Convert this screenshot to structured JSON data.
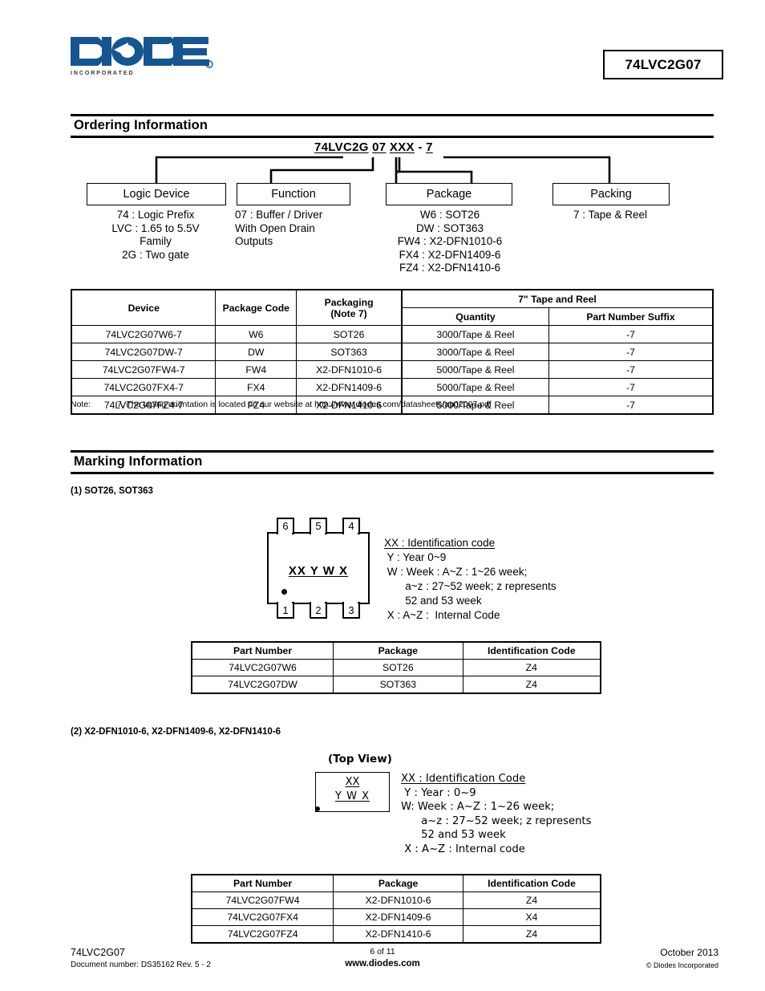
{
  "header": {
    "logo_text": "DIODES",
    "logo_sub": "I N C O R P O R A T E D",
    "logo_color": "#17558f",
    "part_number": "74LVC2G07"
  },
  "sections": {
    "ordering_title": "Ordering Information",
    "marking_title": "Marking Information"
  },
  "ordering_diagram": {
    "code_parts": {
      "p1": "74LVC2G",
      "p2": "07",
      "p3": "XXX",
      "dash": "-",
      "p4": "7"
    },
    "boxes": [
      {
        "label": "Logic Device"
      },
      {
        "label": "Function"
      },
      {
        "label": "Package"
      },
      {
        "label": "Packing"
      }
    ],
    "captions": {
      "logic_device": "74 : Logic Prefix\nLVC : 1.65 to 5.5V\nFamily\n2G : Two gate",
      "function": "07 :  Buffer / Driver\nWith Open Drain\nOutputs",
      "package": "W6 : SOT26\nDW : SOT363\nFW4 : X2-DFN1010-6\nFX4 : X2-DFN1409-6\nFZ4 : X2-DFN1410-6",
      "packing": "7 : Tape & Reel"
    }
  },
  "ordering_table": {
    "headers": {
      "device": "Device",
      "package_code": "Package Code",
      "packaging_l1": "Packaging",
      "packaging_l2": "(Note 7)",
      "tape_reel": "7\" Tape and Reel",
      "quantity": "Quantity",
      "suffix": "Part Number Suffix"
    },
    "rows": [
      {
        "device": "74LVC2G07W6-7",
        "code": "W6",
        "packaging": "SOT26",
        "qty": "3000/Tape & Reel",
        "suffix": "-7"
      },
      {
        "device": "74LVC2G07DW-7",
        "code": "DW",
        "packaging": "SOT363",
        "qty": "3000/Tape & Reel",
        "suffix": "-7"
      },
      {
        "device": "74LVC2G07FW4-7",
        "code": "FW4",
        "packaging": "X2-DFN1010-6",
        "qty": "5000/Tape & Reel",
        "suffix": "-7"
      },
      {
        "device": "74LVC2G07FX4-7",
        "code": "FX4",
        "packaging": "X2-DFN1409-6",
        "qty": "5000/Tape & Reel",
        "suffix": "-7"
      },
      {
        "device": "74LVC2G07FZ4-7",
        "code": "FZ4",
        "packaging": "X2-DFN1410-6",
        "qty": "5000/Tape & Reel",
        "suffix": "-7"
      }
    ]
  },
  "note": {
    "label": "Note:",
    "text": "7. The taping orientation is located on our website at http://www.diodes.com/datasheets/ap02007.pdf"
  },
  "marking1": {
    "heading": "(1) SOT26, SOT363",
    "pins_top": [
      "6",
      "5",
      "4"
    ],
    "pins_bottom": [
      "1",
      "2",
      "3"
    ],
    "mark_line": "XX Y W X",
    "legend_lines": [
      "XX : Identification code",
      " Y : Year 0~9",
      " W : Week : A~Z : 1~26 week;",
      "       a~z : 27~52 week; z represents",
      "       52 and 53 week",
      " X : A~Z :  Internal Code"
    ],
    "table": {
      "headers": {
        "part": "Part Number",
        "package": "Package",
        "ident": "Identification Code"
      },
      "rows": [
        {
          "part": "74LVC2G07W6",
          "package": "SOT26",
          "ident": "Z4"
        },
        {
          "part": "74LVC2G07DW",
          "package": "SOT363",
          "ident": "Z4"
        }
      ]
    }
  },
  "marking2": {
    "heading": "(2) X2-DFN1010-6, X2-DFN1409-6, X2-DFN1410-6",
    "top_view_label": "(Top View)",
    "mark_line1": "XX",
    "mark_line2": "Y W X",
    "legend_lines": [
      "XX : Identification Code",
      " Y : Year : 0~9",
      "W: Week : A~Z : 1~26 week;",
      "      a~z : 27~52 week; z represents",
      "      52 and 53 week",
      " X : A~Z : Internal code"
    ],
    "table": {
      "headers": {
        "part": "Part Number",
        "package": "Package",
        "ident": "Identification Code"
      },
      "rows": [
        {
          "part": "74LVC2G07FW4",
          "package": "X2-DFN1010-6",
          "ident": "Z4"
        },
        {
          "part": "74LVC2G07FX4",
          "package": "X2-DFN1409-6",
          "ident": "X4"
        },
        {
          "part": "74LVC2G07FZ4",
          "package": "X2-DFN1410-6",
          "ident": "Z4"
        }
      ]
    }
  },
  "footer": {
    "left_line1": "74LVC2G07",
    "left_line2": "Document number: DS35162 Rev. 5 - 2",
    "mid_line1": "6 of 11",
    "mid_line2": "www.diodes.com",
    "right_line1": "October 2013",
    "right_line2": "© Diodes Incorporated"
  }
}
